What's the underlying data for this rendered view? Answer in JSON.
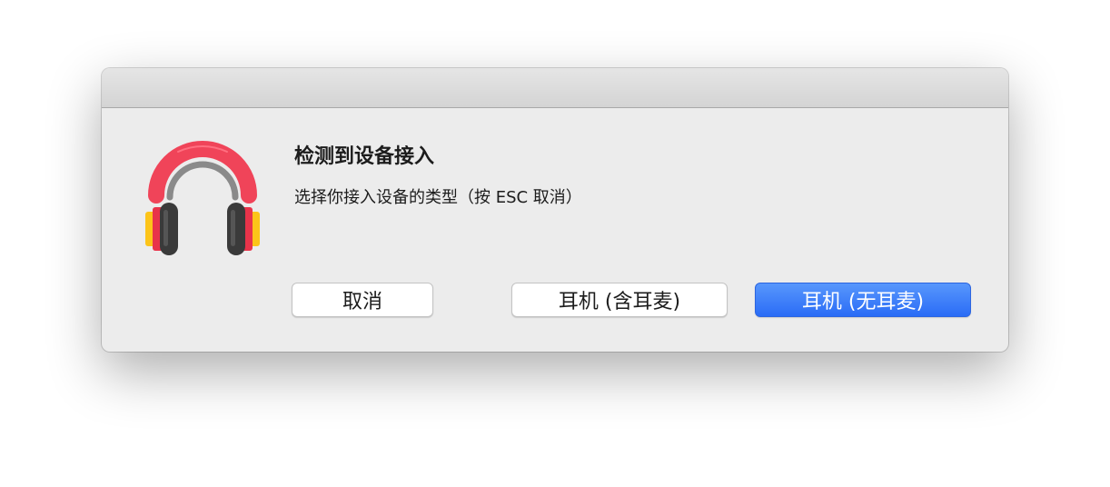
{
  "dialog": {
    "title": "检测到设备接入",
    "message": "选择你接入设备的类型（按 ESC 取消）",
    "icon": "headphones-icon"
  },
  "buttons": {
    "cancel": "取消",
    "with_mic": "耳机 (含耳麦)",
    "without_mic": "耳机 (无耳麦)"
  },
  "colors": {
    "band": "#f04459",
    "inner_band": "#8a8a8a",
    "cup": "#3a3a3a",
    "pad_red": "#e8334a",
    "pad_yellow": "#fcc419",
    "primary_button": "#2a6cf6"
  }
}
